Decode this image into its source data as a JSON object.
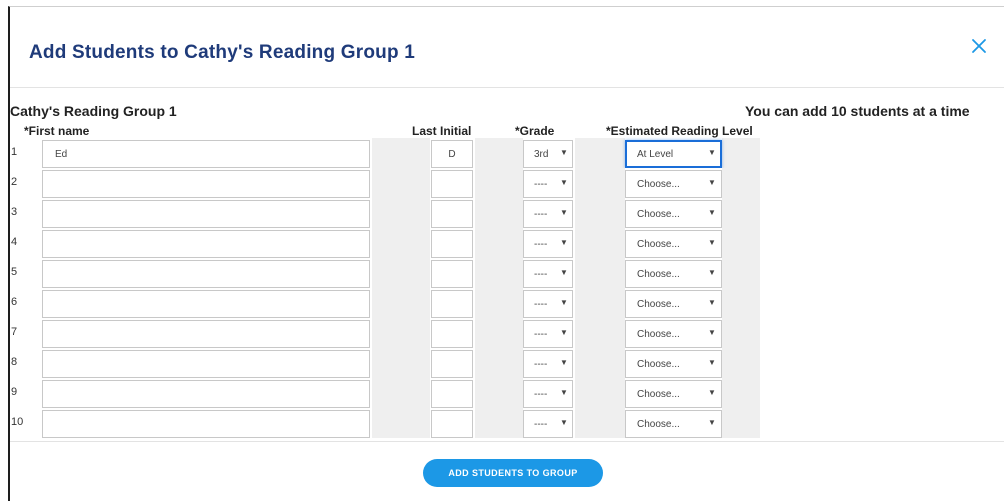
{
  "dialog": {
    "title": "Add Students to Cathy's Reading Group 1",
    "close_icon": "close-icon"
  },
  "group": {
    "name": "Cathy's Reading Group 1",
    "limit_note": "You can add 10 students at a time"
  },
  "columns": {
    "first_name": "*First name",
    "last_initial": "Last Initial",
    "grade": "*Grade",
    "reading_level": "*Estimated Reading Level"
  },
  "rows": [
    {
      "index": "1",
      "first_name": "Ed",
      "last_initial": "D",
      "grade": "3rd",
      "reading_level": "At Level"
    },
    {
      "index": "2",
      "first_name": "",
      "last_initial": "",
      "grade": "----",
      "reading_level": "Choose..."
    },
    {
      "index": "3",
      "first_name": "",
      "last_initial": "",
      "grade": "----",
      "reading_level": "Choose..."
    },
    {
      "index": "4",
      "first_name": "",
      "last_initial": "",
      "grade": "----",
      "reading_level": "Choose..."
    },
    {
      "index": "5",
      "first_name": "",
      "last_initial": "",
      "grade": "----",
      "reading_level": "Choose..."
    },
    {
      "index": "6",
      "first_name": "",
      "last_initial": "",
      "grade": "----",
      "reading_level": "Choose..."
    },
    {
      "index": "7",
      "first_name": "",
      "last_initial": "",
      "grade": "----",
      "reading_level": "Choose..."
    },
    {
      "index": "8",
      "first_name": "",
      "last_initial": "",
      "grade": "----",
      "reading_level": "Choose..."
    },
    {
      "index": "9",
      "first_name": "",
      "last_initial": "",
      "grade": "----",
      "reading_level": "Choose..."
    },
    {
      "index": "10",
      "first_name": "",
      "last_initial": "",
      "grade": "----",
      "reading_level": "Choose..."
    }
  ],
  "actions": {
    "submit_label": "ADD STUDENTS TO GROUP"
  },
  "colors": {
    "title": "#1f3b7a",
    "accent": "#1c98e6",
    "focus": "#1a6ed8"
  }
}
